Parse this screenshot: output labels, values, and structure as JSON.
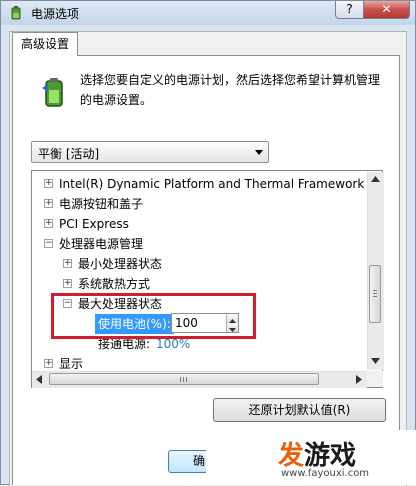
{
  "window": {
    "title": "电源选项",
    "help_label": "?",
    "close_label": "✕",
    "app_icon": "power-options-icon"
  },
  "tab": {
    "label": "高级设置"
  },
  "description": "选择您要自定义的电源计划，然后选择您希望计算机管理的电源设置。",
  "plan": {
    "selected": "平衡 [活动]"
  },
  "tree": {
    "items": [
      {
        "expander": "+",
        "label": "Intel(R) Dynamic Platform and Thermal Framework Se"
      },
      {
        "expander": "+",
        "label": "电源按钮和盖子"
      },
      {
        "expander": "+",
        "label": "PCI Express"
      },
      {
        "expander": "−",
        "label": "处理器电源管理"
      },
      {
        "expander": "+",
        "label": "最小处理器状态"
      },
      {
        "expander": "+",
        "label": "系统散热方式"
      },
      {
        "expander": "−",
        "label": "最大处理器状态"
      },
      {
        "label": "使用电池(%):"
      },
      {
        "label": "接通电源:",
        "value": "100%"
      },
      {
        "expander": "+",
        "label": "显示"
      }
    ],
    "battery_value": "100"
  },
  "buttons": {
    "restore": "还原计划默认值(R)",
    "ok": "确"
  },
  "watermark": {
    "logo_a": "发",
    "logo_b": "游戏",
    "url": "www.fayouxi.com"
  },
  "colors": {
    "highlight_border": "#d01f2a",
    "selected_row_bg": "#3399ff",
    "link_value": "#1e7fc8"
  }
}
